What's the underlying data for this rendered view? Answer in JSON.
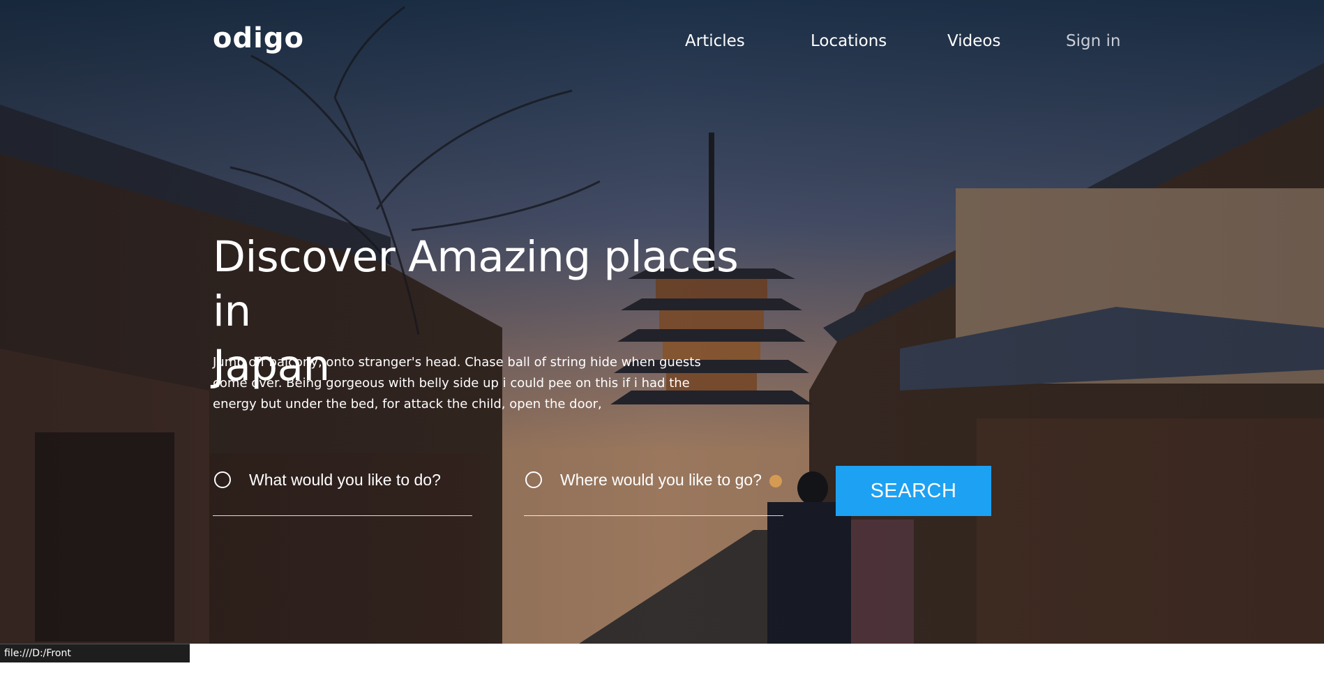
{
  "brand": {
    "logo_text": "odigo"
  },
  "nav": {
    "items": [
      {
        "label": "Articles"
      },
      {
        "label": "Locations"
      },
      {
        "label": "Videos"
      },
      {
        "label": "Sign in"
      }
    ]
  },
  "hero": {
    "headline_line1": "Discover Amazing places in",
    "headline_line2": "Japan",
    "description_line1": "Jump off balcony, onto stranger's head. Chase ball of string hide when guests",
    "description_line2": "come over. Being gorgeous with belly side up i could pee on this if i had the",
    "description_line3": "energy but under the bed, for attack the child, open the door,"
  },
  "search": {
    "activity": {
      "placeholder": "What would you like to do?",
      "value": ""
    },
    "destination": {
      "placeholder": "Where would you like to go?",
      "value": ""
    },
    "button_label": "SEARCH"
  },
  "status": {
    "url": "file:///D:/Front end/figma/index.html#!"
  },
  "colors": {
    "accent": "#1da1f2",
    "text": "#ffffff"
  }
}
